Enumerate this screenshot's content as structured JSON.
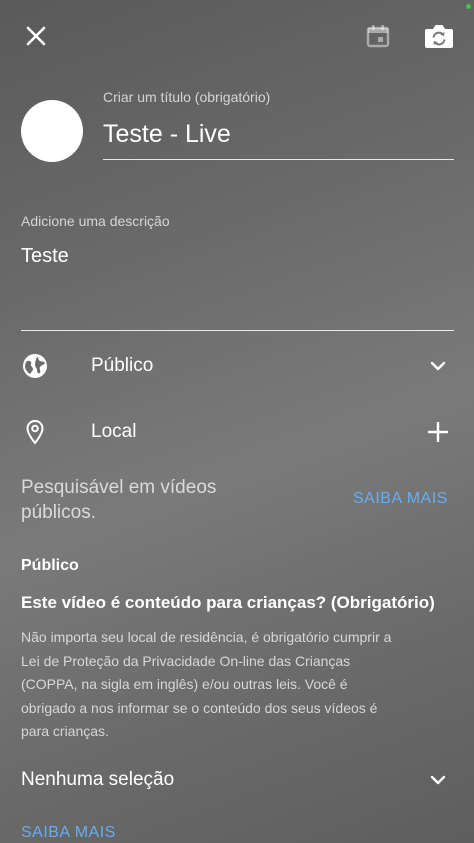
{
  "header": {
    "close_icon": "close-icon",
    "calendar_icon": "calendar-icon",
    "camera_switch_icon": "camera-switch-icon"
  },
  "title_field": {
    "label": "Criar um título (obrigatório)",
    "value": "Teste - Live"
  },
  "description_field": {
    "label": "Adicione uma descrição",
    "value": "Teste"
  },
  "visibility": {
    "label": "Público",
    "icon": "globe-icon"
  },
  "location": {
    "label": "Local",
    "icon": "location-pin-icon"
  },
  "searchable": {
    "text_line1": "Pesquisável em vídeos",
    "text_line2": "públicos.",
    "link": "SAIBA MAIS"
  },
  "audience": {
    "section_title": "Público",
    "question": "Este vídeo é conteúdo para crianças? (Obrigatório)",
    "info_lines": [
      "Não importa seu local de residência, é obrigatório cumprir a",
      "Lei de Proteção da Privacidade On-line das Crianças",
      "(COPPA, na sigla em inglês) e/ou outras leis. Você é",
      "obrigado a nos informar se o conteúdo dos seus vídeos é",
      "para crianças."
    ],
    "selection": "Nenhuma seleção",
    "link": "SAIBA MAIS"
  },
  "colors": {
    "link": "#65aef2",
    "status_dot": "#3ec93e"
  }
}
